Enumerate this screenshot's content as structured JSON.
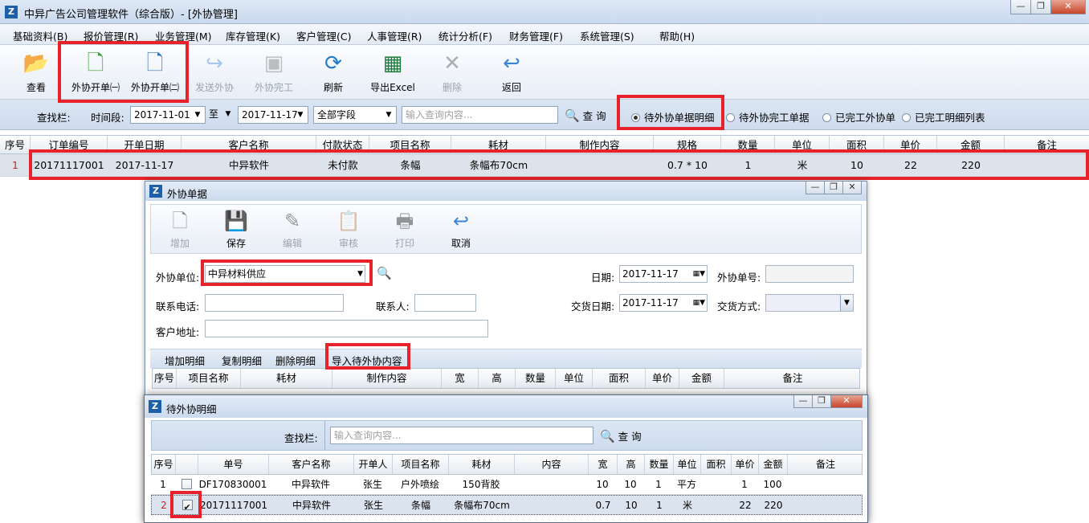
{
  "window": {
    "title": "中异广告公司管理软件（综合版）- [外协管理]"
  },
  "menu": [
    "基础资料(B)",
    "报价管理(R)",
    "业务管理(M)",
    "库存管理(K)",
    "客户管理(C)",
    "人事管理(R)",
    "统计分析(F)",
    "财务管理(F)",
    "系统管理(S)",
    "帮助(H)"
  ],
  "toolbar": {
    "view": "查看",
    "new1": "外协开单㈠",
    "new2": "外协开单㈡",
    "send": "发送外协",
    "done": "外协完工",
    "refresh": "刷新",
    "excel": "导出Excel",
    "delete": "删除",
    "back": "返回"
  },
  "search": {
    "label": "查找栏:",
    "period_label": "时间段:",
    "date_from": "2017-11-01",
    "to_label": "至",
    "date_to": "2017-11-17",
    "field": "全部字段",
    "placeholder": "输入查询内容...",
    "query": "查 询",
    "radios": [
      "待外协单据明细",
      "待外协完工单据",
      "已完工外协单",
      "已完工明细列表"
    ]
  },
  "main_table": {
    "headers": [
      "序号",
      "订单编号",
      "开单日期",
      "客户名称",
      "付款状态",
      "项目名称",
      "耗材",
      "制作内容",
      "规格",
      "数量",
      "单位",
      "面积",
      "单价",
      "金额",
      "备注"
    ],
    "rows": [
      [
        "1",
        "20171117001",
        "2017-11-17",
        "中异软件",
        "未付款",
        "条幅",
        "条幅布70cm",
        "",
        "0.7 * 10",
        "1",
        "米",
        "10",
        "22",
        "220",
        ""
      ]
    ]
  },
  "dialog1": {
    "title": "外协单据",
    "toolbar": {
      "add": "增加",
      "save": "保存",
      "edit": "编辑",
      "audit": "审核",
      "print": "打印",
      "cancel": "取消"
    },
    "form": {
      "unit_label": "外协单位:",
      "unit_value": "中异材料供应",
      "date_label": "日期:",
      "date_value": "2017-11-17",
      "order_no_label": "外协单号:",
      "phone_label": "联系电话:",
      "contact_label": "联系人:",
      "delivery_label": "交货日期:",
      "delivery_value": "2017-11-17",
      "delivery_mode_label": "交货方式:",
      "address_label": "客户地址:"
    },
    "tabs": [
      "增加明细",
      "复制明细",
      "删除明细",
      "导入待外协内容"
    ],
    "headers": [
      "序号",
      "项目名称",
      "耗材",
      "制作内容",
      "宽",
      "高",
      "数量",
      "单位",
      "面积",
      "单价",
      "金额",
      "备注"
    ]
  },
  "dialog2": {
    "title": "待外协明细",
    "search_label": "查找栏:",
    "placeholder": "输入查询内容...",
    "query": "查 询",
    "headers": [
      "序号",
      "",
      "单号",
      "客户名称",
      "开单人",
      "项目名称",
      "耗材",
      "内容",
      "宽",
      "高",
      "数量",
      "单位",
      "面积",
      "单价",
      "金额",
      "备注"
    ],
    "rows": [
      {
        "no": "1",
        "checked": false,
        "cells": [
          "DF170830001",
          "中异软件",
          "张生",
          "户外喷绘",
          "150背胶",
          "",
          "10",
          "10",
          "1",
          "平方",
          "",
          "1",
          "100",
          ""
        ]
      },
      {
        "no": "2",
        "checked": true,
        "cells": [
          "20171117001",
          "中异软件",
          "张生",
          "条幅",
          "条幅布70cm",
          "",
          "0.7",
          "10",
          "1",
          "米",
          "",
          "22",
          "220",
          ""
        ]
      }
    ]
  },
  "colors": {
    "highlight": "#e8222a",
    "accent": "#1d5fa8"
  },
  "icons": {
    "view": "folder-open-icon",
    "new": "new-document-icon",
    "send": "forward-arrow-icon",
    "done": "finish-icon",
    "refresh": "refresh-icon",
    "excel": "excel-icon",
    "delete": "delete-x-icon",
    "back": "back-arrow-icon"
  }
}
